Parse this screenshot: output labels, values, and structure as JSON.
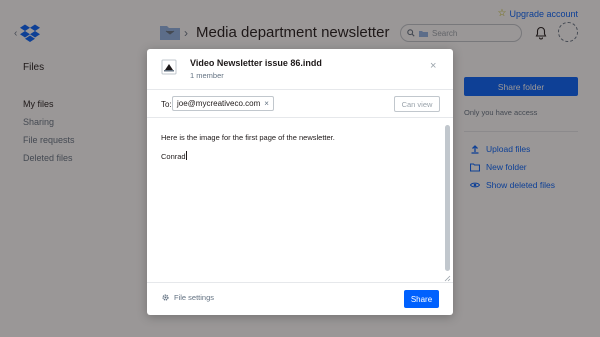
{
  "header": {
    "title": "Media department newsletter",
    "upgrade_label": "Upgrade account",
    "search_placeholder": "Search"
  },
  "sidebar": {
    "section": "Files",
    "items": [
      {
        "label": "My files"
      },
      {
        "label": "Sharing"
      },
      {
        "label": "File requests"
      },
      {
        "label": "Deleted files"
      }
    ]
  },
  "right_panel": {
    "share_folder_label": "Share folder",
    "access_note": "Only you have access",
    "actions": [
      {
        "label": "Upload files",
        "icon": "upload-icon"
      },
      {
        "label": "New folder",
        "icon": "new-folder-icon"
      },
      {
        "label": "Show deleted files",
        "icon": "eye-icon"
      }
    ]
  },
  "modal": {
    "file_name": "Video Newsletter issue 86.indd",
    "member_count": "1 member",
    "to_label": "To:",
    "recipient": "joe@mycreativeco.com",
    "permission": "Can view",
    "message_line1": "Here is the image for the first page of the newsletter.",
    "message_line2": "Conrad",
    "file_settings_label": "File settings",
    "share_label": "Share"
  },
  "colors": {
    "accent": "#0061fe",
    "overlay": "#1e1919"
  }
}
